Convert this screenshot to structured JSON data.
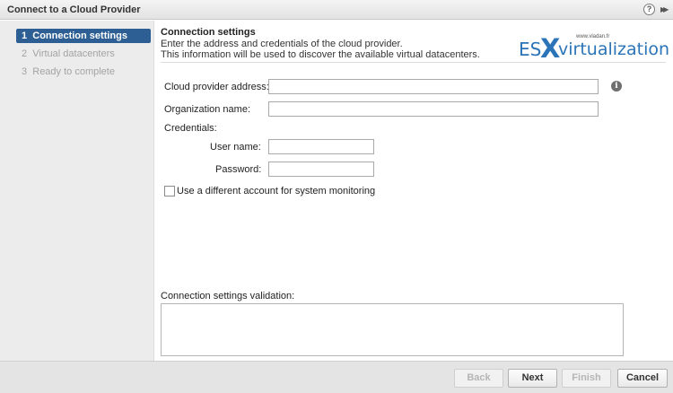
{
  "window": {
    "title": "Connect to a Cloud Provider",
    "help_glyph": "?",
    "expand_glyph": "▶▶"
  },
  "sidebar": {
    "steps": [
      {
        "number": "1",
        "label": "Connection settings",
        "active": true
      },
      {
        "number": "2",
        "label": "Virtual datacenters",
        "active": false
      },
      {
        "number": "3",
        "label": "Ready to complete",
        "active": false
      }
    ]
  },
  "content": {
    "section_title": "Connection settings",
    "description_line1": "Enter the address and credentials of the cloud provider.",
    "description_line2": "This information will be used to discover the available virtual datacenters.",
    "logo": {
      "es": "ES",
      "x": "X",
      "virtualization": "virtualization",
      "site": "www.vladan.fr"
    },
    "form": {
      "cloud_provider_address_label": "Cloud provider address:",
      "cloud_provider_address_value": "",
      "organization_name_label": "Organization name:",
      "organization_name_value": "",
      "credentials_label": "Credentials:",
      "user_name_label": "User name:",
      "user_name_value": "",
      "password_label": "Password:",
      "password_value": "",
      "different_account_label": "Use a different account for system monitoring",
      "different_account_checked": false
    },
    "validation_label": "Connection settings validation:",
    "info_glyph": "i"
  },
  "footer": {
    "back_label": "Back",
    "next_label": "Next",
    "finish_label": "Finish",
    "cancel_label": "Cancel"
  },
  "colors": {
    "active_step_bg": "#2d5f95",
    "logo_blue": "#2b74b8"
  }
}
